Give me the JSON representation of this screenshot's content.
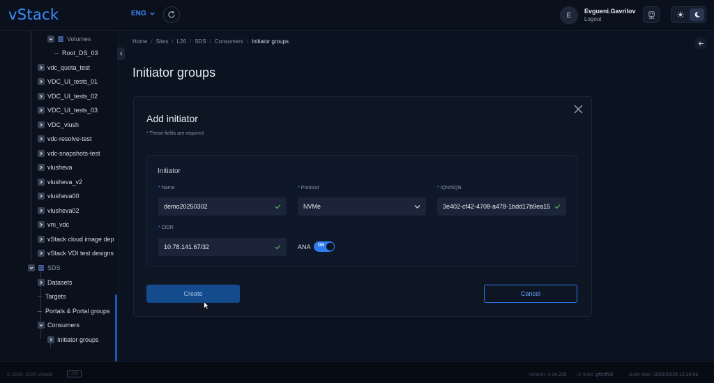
{
  "topbar": {
    "logo": "vStack",
    "language": "ENG",
    "user_initial": "E",
    "user_name": "Evgueni.Gavrilov",
    "logout_label": "Logout"
  },
  "sidebar": {
    "items": [
      {
        "label": "Volumes",
        "type": "expanded-db"
      },
      {
        "label": "Root_DS_03",
        "type": "leaf"
      },
      {
        "label": "vdc_quota_test",
        "type": "collapsed"
      },
      {
        "label": "VDC_UI_tests_01",
        "type": "collapsed"
      },
      {
        "label": "VDC_UI_tests_02",
        "type": "collapsed"
      },
      {
        "label": "VDC_UI_tests_03",
        "type": "collapsed"
      },
      {
        "label": "VDC_vlush",
        "type": "collapsed"
      },
      {
        "label": "vdc-resolve-test",
        "type": "collapsed"
      },
      {
        "label": "vdc-snapshots-test",
        "type": "collapsed"
      },
      {
        "label": "vlusheva",
        "type": "collapsed"
      },
      {
        "label": "vlusheva_v2",
        "type": "collapsed"
      },
      {
        "label": "vlusheva00",
        "type": "collapsed"
      },
      {
        "label": "vlusheva02",
        "type": "collapsed"
      },
      {
        "label": "vm_vdc",
        "type": "collapsed"
      },
      {
        "label": "vStack cloud image dep",
        "type": "collapsed"
      },
      {
        "label": "vStack VDI test designs",
        "type": "collapsed"
      },
      {
        "label": "SDS",
        "type": "expanded-db"
      },
      {
        "label": "Datasets",
        "type": "collapsed"
      },
      {
        "label": "Targets",
        "type": "leaf"
      },
      {
        "label": "Portals & Portal groups",
        "type": "leaf"
      },
      {
        "label": "Consumers",
        "type": "expanded"
      },
      {
        "label": "Initiator groups",
        "type": "collapsed"
      }
    ]
  },
  "breadcrumb": [
    "Home",
    "Sites",
    "L26",
    "SDS",
    "Consumers",
    "Initiator groups"
  ],
  "page_title": "Initiator groups",
  "form": {
    "title": "Add initiator",
    "required_note": "These fields are required",
    "section_title": "Initiator",
    "name_label": "Name",
    "name_value": "demo20250302",
    "protocol_label": "Protocol",
    "protocol_value": "NVMe",
    "iqn_label": "IQN/NQN",
    "iqn_value": "3e402-cf42-4708-a478-1bdd17b9ea15",
    "cidr_label": "CIDR",
    "cidr_value": "10.78.141.67/32",
    "ana_label": "ANA",
    "ana_state": "ON",
    "create_label": "Create",
    "cancel_label": "Cancel"
  },
  "footer": {
    "copyright": "© 2020–2025 vStack",
    "log_label": "LOG",
    "version_label": "Version:",
    "version_value": "4.34.229",
    "uifix_label": "UI fixes:",
    "uifix_value": "gf6cff0d",
    "build_label": "Build date:",
    "build_value": "2025/02/26 12:29:53"
  },
  "colors": {
    "accent": "#3b8cff",
    "background": "#0b1220",
    "panel": "#0e1624",
    "success": "#4caf50"
  }
}
